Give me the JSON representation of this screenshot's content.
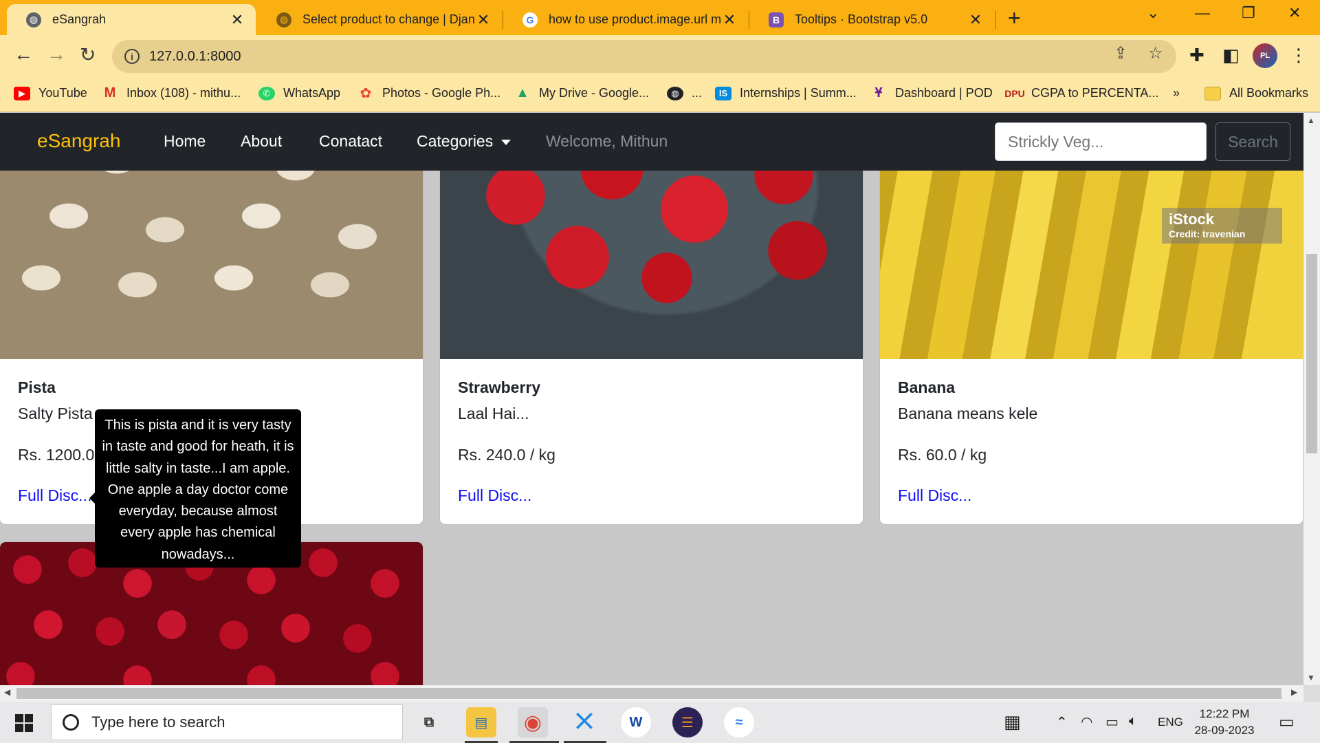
{
  "browser": {
    "tabs": [
      {
        "title": "eSangrah",
        "active": true,
        "icon": "globe-icon"
      },
      {
        "title": "Select product to change | Djang",
        "active": false,
        "icon": "globe-icon"
      },
      {
        "title": "how to use product.image.url m",
        "active": false,
        "icon": "google-icon"
      },
      {
        "title": "Tooltips · Bootstrap v5.0",
        "active": false,
        "icon": "bootstrap-icon"
      }
    ],
    "url": "127.0.0.1:8000",
    "bookmarks": [
      {
        "label": "YouTube",
        "icon": "youtube-icon"
      },
      {
        "label": "Inbox (108) - mithu...",
        "icon": "gmail-icon"
      },
      {
        "label": "WhatsApp",
        "icon": "whatsapp-icon"
      },
      {
        "label": "Photos - Google Ph...",
        "icon": "google-photos-icon"
      },
      {
        "label": "My Drive - Google...",
        "icon": "google-drive-icon"
      },
      {
        "label": "...",
        "icon": "globe-icon"
      },
      {
        "label": "Internships | Summ...",
        "icon": "internshala-icon"
      },
      {
        "label": "Dashboard | POD",
        "icon": "pod-icon"
      },
      {
        "label": "CGPA to PERCENTA...",
        "icon": "dpu-icon"
      }
    ],
    "overflow_label": "»",
    "all_bookmarks_label": "All Bookmarks",
    "theme_color": "#fbb011"
  },
  "site": {
    "brand": "eSangrah",
    "nav": {
      "home": "Home",
      "about": "About",
      "contact": "Conatact",
      "categories": "Categories",
      "welcome": "Welcome, Mithun"
    },
    "search": {
      "placeholder": "Strickly Veg...",
      "button": "Search"
    },
    "products": [
      {
        "name": "Pista",
        "desc": "Salty Pista",
        "price": "Rs. 1200.0 / kg",
        "link": "Full Disc..."
      },
      {
        "name": "Strawberry",
        "desc": "Laal Hai...",
        "price": "Rs. 240.0 / kg",
        "link": "Full Disc..."
      },
      {
        "name": "Banana",
        "desc": "Banana means kele",
        "price": "Rs. 60.0 / kg",
        "link": "Full Disc..."
      }
    ],
    "image_watermark": {
      "brand": "iStock",
      "credit": "Credit: travenian"
    },
    "tooltip": "This is pista and it is very tasty in taste and good for heath, it is little salty in taste...I am apple. One apple a day doctor come everyday, because almost every apple has chemical nowadays...",
    "colors": {
      "brand": "#ffc107",
      "navbar": "#212529",
      "link": "#0d0df0"
    }
  },
  "taskbar": {
    "search_placeholder": "Type here to search",
    "language": "ENG",
    "time": "12:22 PM",
    "date": "28-09-2023"
  }
}
